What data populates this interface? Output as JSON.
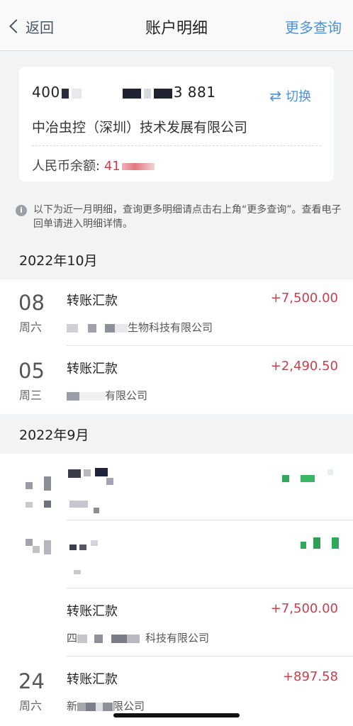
{
  "nav": {
    "back_label": "返回",
    "title": "账户明细",
    "more_label": "更多查询"
  },
  "account": {
    "number_prefix": "400",
    "number_suffix": "3 881",
    "switch_label": "切换",
    "switch_icon": "swap-icon",
    "company": "中冶虫控（深圳）技术发展有限公司",
    "balance_label": "人民币余额:",
    "balance_visible": "41"
  },
  "notice": {
    "text": "以下为近一月明细，查询更多明细请点击右上角“更多查询”。查看电子回单请进入明细详情。"
  },
  "months": [
    {
      "label": "2022年10月",
      "transactions": [
        {
          "day": "08",
          "weekday": "周六",
          "type": "转账汇款",
          "amount": "+7,500.00",
          "counterparty_visible": "生物科技有限公司"
        },
        {
          "day": "05",
          "weekday": "周三",
          "type": "转账汇款",
          "amount": "+2,490.50",
          "counterparty_visible": "有限公司"
        }
      ]
    },
    {
      "label": "2022年9月",
      "transactions": [
        {
          "day": "",
          "weekday": "",
          "type": "",
          "amount": "",
          "counterparty_visible": ""
        },
        {
          "day": "",
          "weekday": "",
          "type": "",
          "amount": "",
          "counterparty_visible": ""
        },
        {
          "day": "",
          "weekday": "",
          "type": "转账汇款",
          "amount": "+7,500.00",
          "counterparty_visible": "科技有限公司",
          "counterparty_prefix": "四"
        },
        {
          "day": "24",
          "weekday": "周六",
          "type": "转账汇款",
          "amount": "+897.58",
          "counterparty_visible": "限公司",
          "counterparty_prefix": "新"
        }
      ]
    }
  ],
  "colors": {
    "accent_blue": "#4d90d6",
    "amount_red": "#c8404a",
    "background": "#f2f3f5"
  }
}
